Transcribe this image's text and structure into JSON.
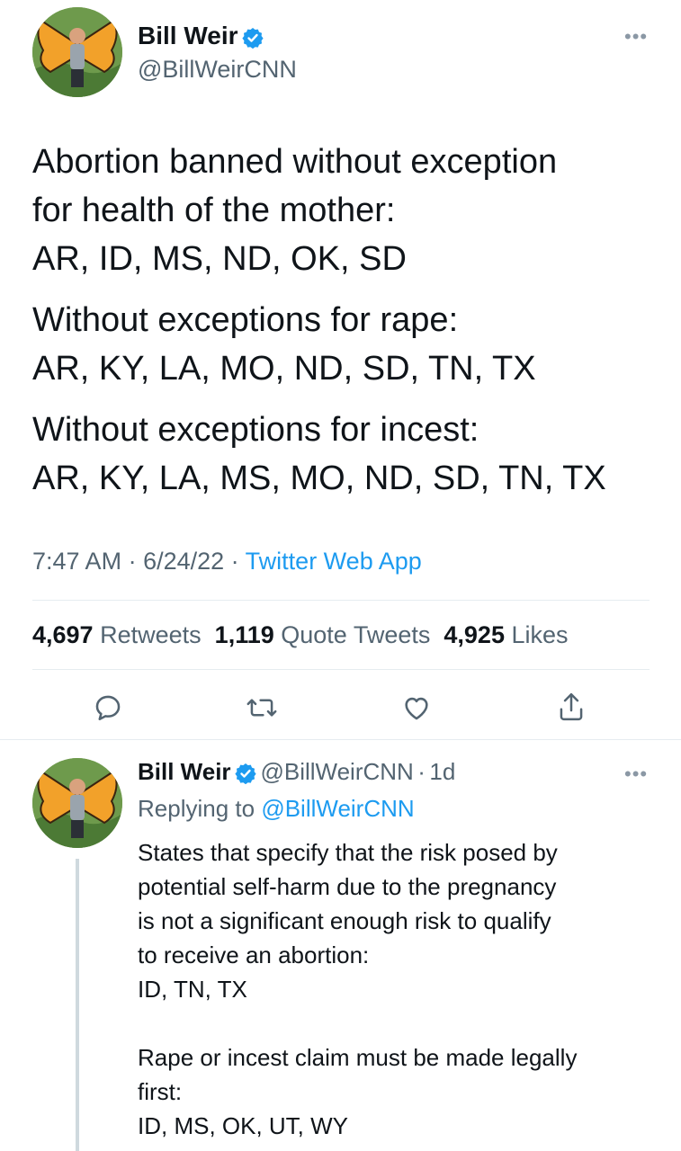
{
  "tweet": {
    "author_name": "Bill Weir",
    "author_handle": "@BillWeirCNN",
    "more_icon": "more-horizontal-icon",
    "lines": [
      "Abortion banned without exception",
      "for health of the mother:",
      "AR, ID, MS, ND, OK, SD",
      "Without exceptions for rape:",
      "AR, KY, LA, MO, ND, SD, TN, TX",
      "Without exceptions for incest:",
      "AR, KY, LA, MS, MO, ND, SD, TN, TX"
    ],
    "time": "7:47 AM",
    "date": "6/24/22",
    "source": "Twitter Web App",
    "stats": {
      "retweets_count": "4,697",
      "retweets_label": "Retweets",
      "quotes_count": "1,119",
      "quotes_label": "Quote Tweets",
      "likes_count": "4,925",
      "likes_label": "Likes"
    },
    "actions": [
      "reply-icon",
      "retweet-icon",
      "like-icon",
      "share-icon"
    ]
  },
  "reply": {
    "author_name": "Bill Weir",
    "author_handle": "@BillWeirCNN",
    "age": "1d",
    "replying_prefix": "Replying to",
    "replying_handle": "@BillWeirCNN",
    "lines": [
      "States that specify that the risk posed by",
      "potential self-harm due to the pregnancy",
      "is not a significant enough risk to qualify",
      "to receive an abortion:",
      "ID, TN, TX",
      "",
      "Rape or incest claim must be made legally",
      "first:",
      "ID, MS, OK, UT, WY"
    ]
  },
  "colors": {
    "accent": "#1d9bf0",
    "muted": "#536471",
    "text": "#0f1419"
  }
}
